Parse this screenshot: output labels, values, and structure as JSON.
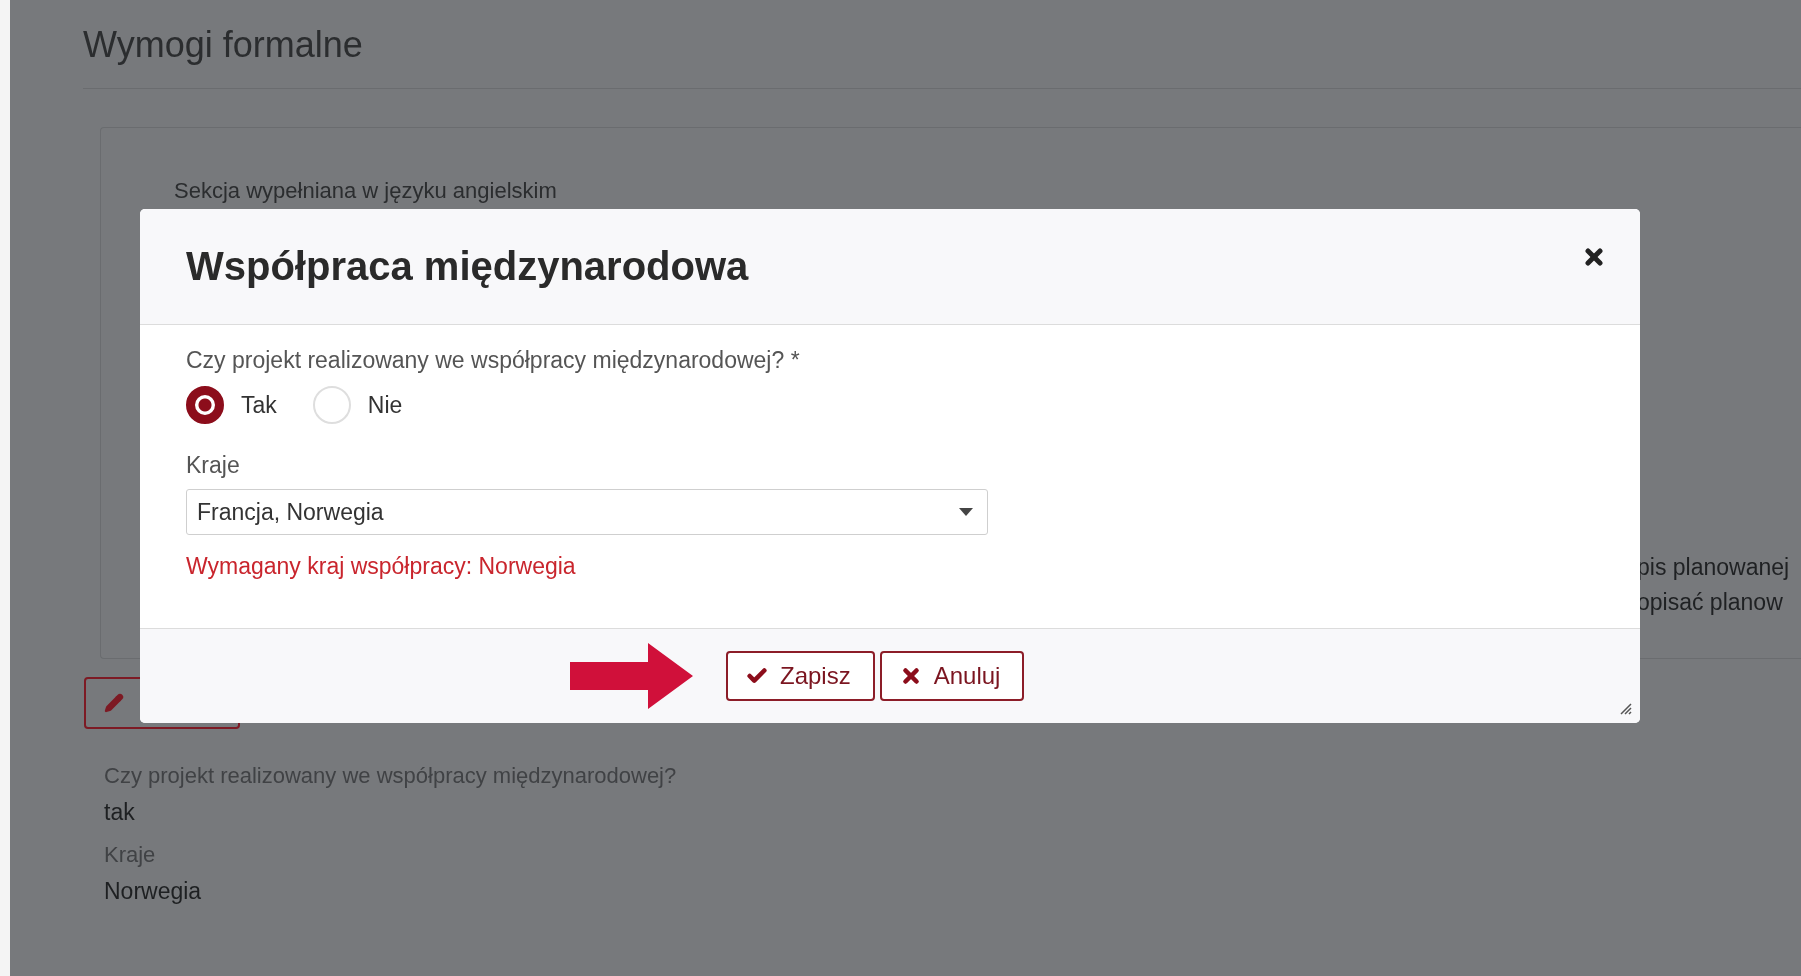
{
  "page": {
    "title": "Wymogi formalne",
    "section_note": "Sekcja wypełniana w języku angielskim",
    "side_text": [
      "pis planowanej",
      "opisać planow"
    ],
    "details": [
      {
        "label": "Czy projekt realizowany we współpracy międzynarodowej?",
        "value": "tak"
      },
      {
        "label": "Kraje",
        "value": "Norwegia"
      }
    ]
  },
  "dialog": {
    "title": "Współpraca międzynarodowa",
    "question": "Czy projekt realizowany we współpracy międzynarodowej? *",
    "options": [
      {
        "label": "Tak",
        "selected": true
      },
      {
        "label": "Nie",
        "selected": false
      }
    ],
    "countries_label": "Kraje",
    "countries_value": "Francja, Norwegia",
    "error": "Wymagany kraj współpracy: Norwegia",
    "buttons": [
      {
        "label": "Zapisz",
        "kind": "save"
      },
      {
        "label": "Anuluj",
        "kind": "cancel"
      }
    ]
  }
}
